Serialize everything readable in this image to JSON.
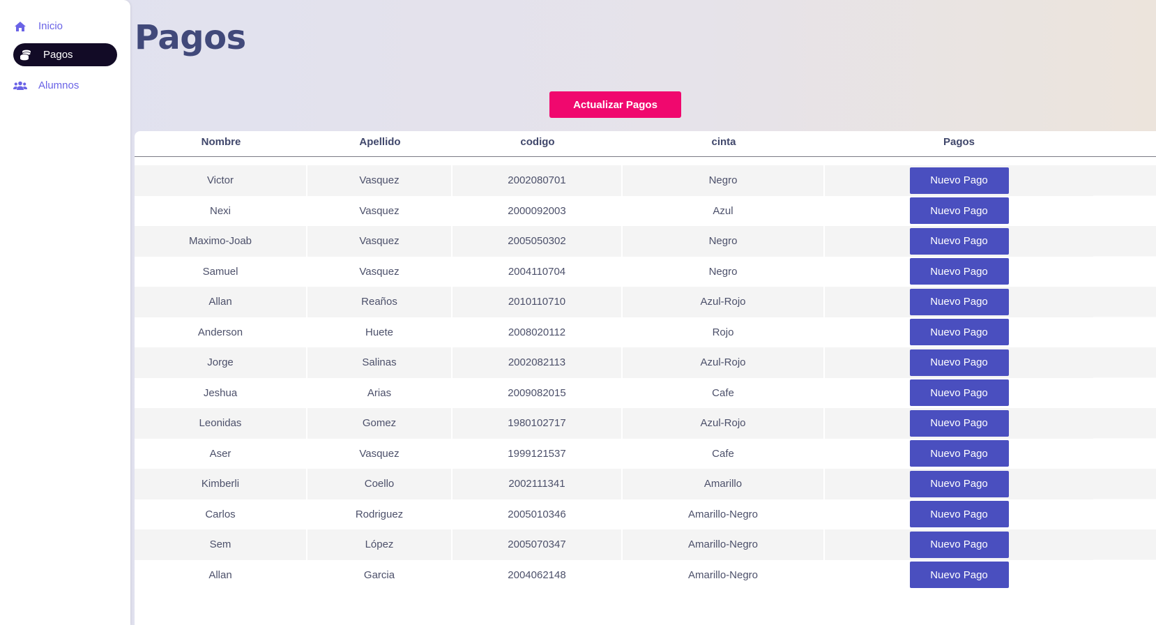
{
  "sidebar": {
    "items": [
      {
        "label": "Inicio",
        "icon": "home-icon"
      },
      {
        "label": "Pagos",
        "icon": "coins-icon",
        "active": true
      },
      {
        "label": "Alumnos",
        "icon": "users-icon"
      }
    ]
  },
  "page": {
    "title": "Pagos",
    "refresh_button_label": "Actualizar Pagos"
  },
  "table": {
    "columns": [
      "Nombre",
      "Apellido",
      "codigo",
      "cinta",
      "Pagos"
    ],
    "action_label": "Nuevo Pago",
    "rows": [
      {
        "nombre": "Victor",
        "apellido": "Vasquez",
        "codigo": "2002080701",
        "cinta": "Negro"
      },
      {
        "nombre": "Nexi",
        "apellido": "Vasquez",
        "codigo": "2000092003",
        "cinta": "Azul"
      },
      {
        "nombre": "Maximo-Joab",
        "apellido": "Vasquez",
        "codigo": "2005050302",
        "cinta": "Negro"
      },
      {
        "nombre": "Samuel",
        "apellido": "Vasquez",
        "codigo": "2004110704",
        "cinta": "Negro"
      },
      {
        "nombre": "Allan",
        "apellido": "Reaños",
        "codigo": "2010110710",
        "cinta": "Azul-Rojo"
      },
      {
        "nombre": "Anderson",
        "apellido": "Huete",
        "codigo": "2008020112",
        "cinta": "Rojo"
      },
      {
        "nombre": "Jorge",
        "apellido": "Salinas",
        "codigo": "2002082113",
        "cinta": "Azul-Rojo"
      },
      {
        "nombre": "Jeshua",
        "apellido": "Arias",
        "codigo": "2009082015",
        "cinta": "Cafe"
      },
      {
        "nombre": "Leonidas",
        "apellido": "Gomez",
        "codigo": "1980102717",
        "cinta": "Azul-Rojo"
      },
      {
        "nombre": "Aser",
        "apellido": "Vasquez",
        "codigo": "1999121537",
        "cinta": "Cafe"
      },
      {
        "nombre": "Kimberli",
        "apellido": "Coello",
        "codigo": "2002111341",
        "cinta": "Amarillo"
      },
      {
        "nombre": "Carlos",
        "apellido": "Rodriguez",
        "codigo": "2005010346",
        "cinta": "Amarillo-Negro"
      },
      {
        "nombre": "Sem",
        "apellido": "López",
        "codigo": "2005070347",
        "cinta": "Amarillo-Negro"
      },
      {
        "nombre": "Allan",
        "apellido": "Garcia",
        "codigo": "2004062148",
        "cinta": "Amarillo-Negro"
      }
    ]
  },
  "colors": {
    "accent_pink": "#f0086e",
    "button_indigo": "#4a4fbf",
    "active_nav_bg": "#120b26",
    "nav_text": "#6a63e6",
    "title_text": "#41497a"
  }
}
